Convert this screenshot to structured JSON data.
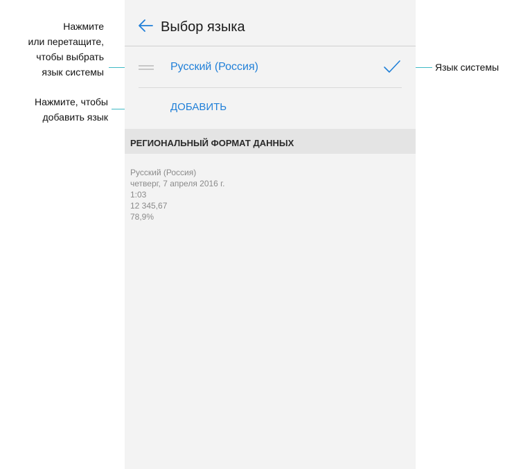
{
  "header": {
    "title": "Выбор языка",
    "back_icon": "arrow-left-icon"
  },
  "language_list": [
    {
      "label": "Русский (Россия)",
      "selected": true
    }
  ],
  "add_label": "ДОБАВИТЬ",
  "regional": {
    "title": "РЕГИОНАЛЬНЫЙ ФОРМАТ ДАННЫХ",
    "lines": [
      "Русский (Россия)",
      "четверг, 7 апреля 2016 г.",
      "1:03",
      "12 345,67",
      "78,9%"
    ]
  },
  "callouts": {
    "drag_lines": [
      "Нажмите",
      "или перетащите,",
      "чтобы выбрать",
      "язык системы"
    ],
    "add_lines": [
      "Нажмите, чтобы",
      "добавить язык"
    ],
    "system": "Язык системы"
  },
  "colors": {
    "accent": "#1f7fd8",
    "leader": "#3db9c4",
    "screen_bg": "#f3f3f3",
    "section_bg": "#e4e4e4"
  }
}
